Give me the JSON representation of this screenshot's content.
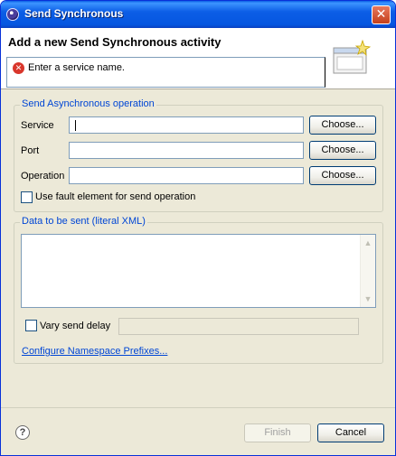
{
  "window": {
    "title": "Send Synchronous",
    "close_icon": "close-icon",
    "app_icon": "eclipse-icon"
  },
  "header": {
    "title": "Add a new Send Synchronous activity",
    "message": "Enter a service name.",
    "message_icon": "error-icon",
    "error_glyph": "✕",
    "banner_icon": "wizard-banner-icon"
  },
  "operation_group": {
    "label": "Send Asynchronous operation",
    "service_label": "Service",
    "service_value": "",
    "port_label": "Port",
    "port_value": "",
    "operation_label": "Operation",
    "operation_value": "",
    "choose_label": "Choose...",
    "fault_checkbox_label": "Use fault element for send operation",
    "fault_checked": false
  },
  "data_group": {
    "label": "Data to be sent (literal XML)",
    "xml_value": "",
    "vary_delay_label": "Vary send delay",
    "vary_delay_checked": false,
    "delay_value": "",
    "namespace_link": "Configure Namespace Prefixes..."
  },
  "footer": {
    "help_glyph": "?",
    "finish_label": "Finish",
    "cancel_label": "Cancel",
    "scroll_up_glyph": "▲",
    "scroll_down_glyph": "▼"
  }
}
